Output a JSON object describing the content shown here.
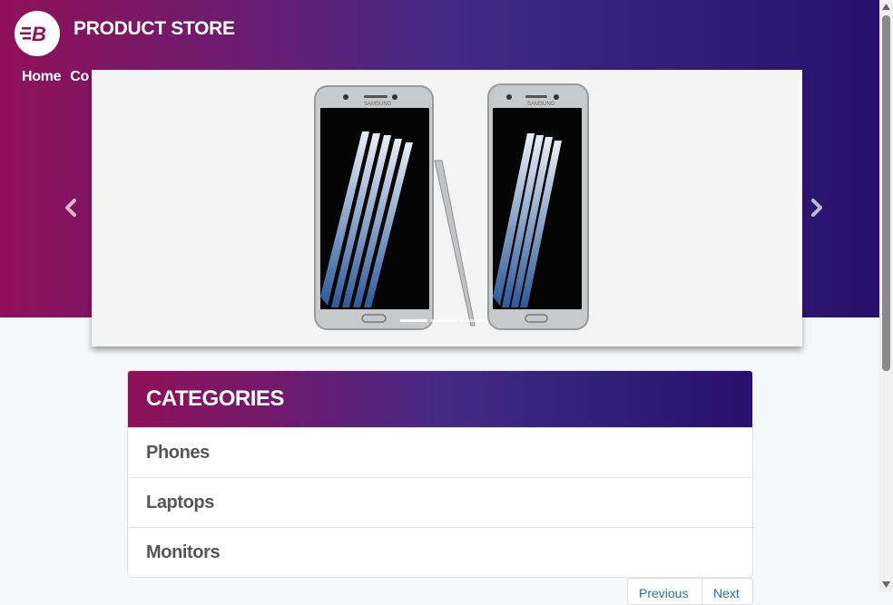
{
  "brand": {
    "title": "PRODUCT STORE",
    "logo_letter": "B"
  },
  "nav": {
    "items": [
      {
        "label": "Home"
      },
      {
        "label": "Co"
      }
    ]
  },
  "carousel": {
    "product_image_brand": "SAMSUNG",
    "slide_count": 3,
    "active_index": 0,
    "prev_icon": "chevron-left-icon",
    "next_icon": "chevron-right-icon"
  },
  "categories": {
    "title": "CATEGORIES",
    "items": [
      {
        "label": "Phones"
      },
      {
        "label": "Laptops"
      },
      {
        "label": "Monitors"
      }
    ]
  },
  "pagination": {
    "previous_label": "Previous",
    "next_label": "Next"
  },
  "colors": {
    "gradient_start": "#901059",
    "gradient_mid": "#452a86",
    "gradient_end": "#2a0f6e",
    "link": "#1f6fb5",
    "category_text": "#555555"
  }
}
